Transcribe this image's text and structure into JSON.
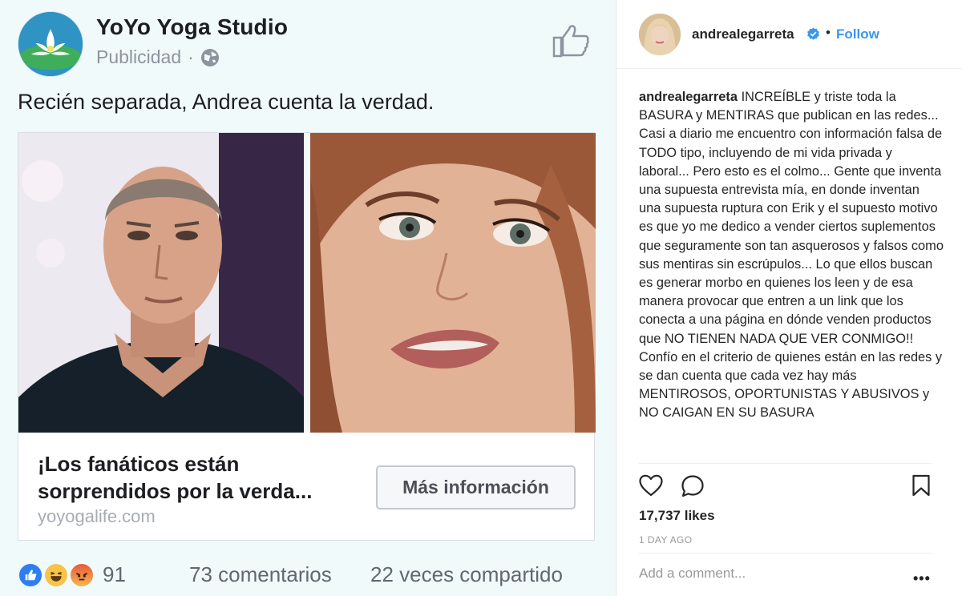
{
  "facebook_ad": {
    "page_name": "YoYo Yoga Studio",
    "sponsored_label": "Publicidad",
    "separator": "·",
    "post_text": "Recién separada, Andrea cuenta la verdad.",
    "headline_line1": "¡Los fanáticos están",
    "headline_line2": "sorprendidos por la verda...",
    "domain": "yoyogalife.com",
    "cta_label": "Más información",
    "reactions_count": "91",
    "comments": "73 comentarios",
    "shares": "22 veces compartido",
    "reaction_icons": [
      "like-icon",
      "haha-icon",
      "angry-icon"
    ]
  },
  "instagram": {
    "username": "andrealegarreta",
    "dot": "•",
    "follow_label": "Follow",
    "caption_user": "andrealegarreta",
    "caption_text": "INCREÍBLE y triste toda la BASURA y MENTIRAS que publican en las redes... Casi a diario me encuentro con información falsa de TODO tipo, incluyendo de mi vida privada y laboral... Pero esto es el colmo... Gente que inventa una supuesta entrevista mía, en donde inventan una supuesta ruptura con Erik y el supuesto motivo es que yo me dedico a vender ciertos suplementos que seguramente son tan asquerosos y falsos como sus mentiras sin escrúpulos... Lo que ellos buscan es generar morbo en quienes los leen y de esa manera provocar que entren a un link que los conecta a una página en dónde venden productos que NO TIENEN NADA QUE VER CONMIGO!! Confío en el criterio de quienes están en las redes y se dan cuenta que cada vez hay más MENTIROSOS, OPORTUNISTAS Y ABUSIVOS y NO CAIGAN EN SU BASURA",
    "likes": "17,737 likes",
    "time": "1 DAY AGO",
    "add_comment_placeholder": "Add a comment...",
    "more_label": "•••",
    "accent_color": "#3897f0"
  }
}
